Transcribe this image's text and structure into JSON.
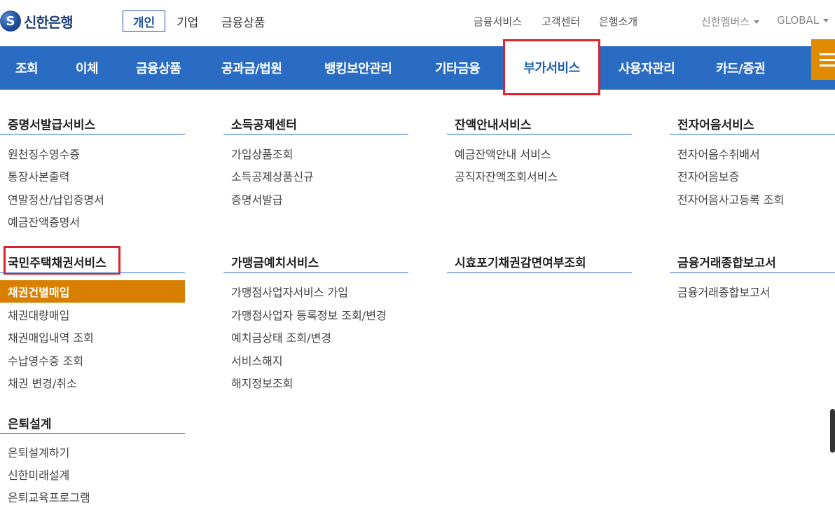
{
  "brand": {
    "logo_text": "신한은행"
  },
  "top_tabs": {
    "personal": "개인",
    "corporate": "기업",
    "products": "금융상품"
  },
  "util_links": {
    "fin_service": "금융서비스",
    "customer_center": "고객센터",
    "bank_intro": "은행소개",
    "members": "신한멤버스",
    "global": "GLOBAL"
  },
  "nav": {
    "items": [
      "조회",
      "이체",
      "금융상품",
      "공과금/법원",
      "뱅킹보안관리",
      "기타금융",
      "부가서비스",
      "사용자관리",
      "카드/증권"
    ],
    "active_index": 6
  },
  "colors": {
    "nav_bg": "#2a6cc4",
    "accent_orange": "#d97f00",
    "highlight_red": "#e0202c",
    "brand_navy": "#1d3f7a"
  },
  "menu": {
    "cert": {
      "title": "증명서발급서비스",
      "links": [
        "원천징수영수증",
        "통장사본출력",
        "연말정산/납입증명서",
        "예금잔액증명서"
      ]
    },
    "tax": {
      "title": "소득공제센터",
      "links": [
        "가입상품조회",
        "소득공제상품신규",
        "증명서발급"
      ]
    },
    "balance": {
      "title": "잔액안내서비스",
      "links": [
        "예금잔액안내 서비스",
        "공직자잔액조회서비스"
      ]
    },
    "ebill": {
      "title": "전자어음서비스",
      "links": [
        "전자어음수취배서",
        "전자어음보증",
        "전자어음사고등록 조회"
      ]
    },
    "bond": {
      "title": "국민주택채권서비스",
      "active_link": "채권건별매입",
      "links": [
        "채권대량매입",
        "채권매입내역 조회",
        "수납영수증 조회",
        "채권 변경/취소"
      ]
    },
    "merchant": {
      "title": "가맹금예치서비스",
      "links": [
        "가맹점사업자서비스 가입",
        "가맹점사업자 등록정보 조회/변경",
        "예치금상태 조회/변경",
        "서비스해지",
        "해지정보조회"
      ]
    },
    "prescription": {
      "title": "시효포기채권감면여부조회",
      "links": []
    },
    "report": {
      "title": "금융거래종합보고서",
      "links": [
        "금융거래종합보고서"
      ]
    },
    "retire": {
      "title": "은퇴설계",
      "links": [
        "은퇴설계하기",
        "신한미래설계",
        "은퇴교육프로그램"
      ]
    }
  }
}
